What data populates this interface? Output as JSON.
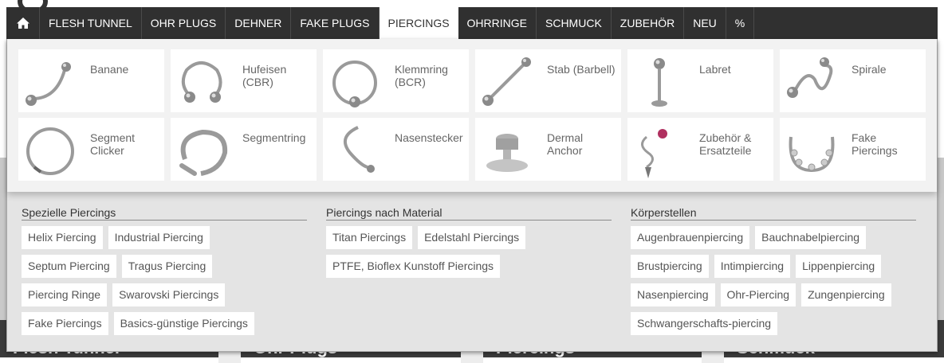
{
  "background": {
    "categories": [
      "Flesh Tunnel",
      "Ohr Plugs",
      "Piercings",
      "Schmuck"
    ]
  },
  "nav": {
    "home_icon": "home-icon",
    "items": [
      {
        "label": "FLESH TUNNEL"
      },
      {
        "label": "OHR PLUGS"
      },
      {
        "label": "DEHNER"
      },
      {
        "label": "FAKE PLUGS"
      },
      {
        "label": "PIERCINGS",
        "active": true
      },
      {
        "label": "OHRRINGE"
      },
      {
        "label": "SCHMUCK"
      },
      {
        "label": "ZUBEHÖR"
      },
      {
        "label": "NEU"
      },
      {
        "label": "%"
      }
    ]
  },
  "tiles": [
    {
      "label": "Banane",
      "icon": "banana-piercing-icon"
    },
    {
      "label": "Hufeisen (CBR)",
      "icon": "horseshoe-piercing-icon"
    },
    {
      "label": "Klemmring (BCR)",
      "icon": "ball-closure-ring-icon"
    },
    {
      "label": "Stab (Barbell)",
      "icon": "barbell-icon"
    },
    {
      "label": "Labret",
      "icon": "labret-icon"
    },
    {
      "label": "Spirale",
      "icon": "spiral-piercing-icon"
    },
    {
      "label": "Segment Clicker",
      "icon": "segment-clicker-icon"
    },
    {
      "label": "Segmentring",
      "icon": "segment-ring-icon"
    },
    {
      "label": "Nasenstecker",
      "icon": "nose-stud-icon"
    },
    {
      "label": "Dermal Anchor",
      "icon": "dermal-anchor-icon"
    },
    {
      "label": "Zubehör & Ersatzteile",
      "icon": "accessories-icon"
    },
    {
      "label": "Fake Piercings",
      "icon": "fake-piercing-icon"
    }
  ],
  "columns": [
    {
      "title": "Spezielle Piercings",
      "links": [
        "Helix Piercing",
        "Industrial Piercing",
        "Septum Piercing",
        "Tragus Piercing",
        "Piercing Ringe",
        "Swarovski Piercings",
        "Fake Piercings",
        "Basics-günstige Piercings"
      ]
    },
    {
      "title": "Piercings nach Material",
      "links": [
        "Titan Piercings",
        "Edelstahl Piercings",
        "PTFE, Bioflex Kunstoff Piercings"
      ]
    },
    {
      "title": "Körperstellen",
      "links": [
        "Augenbrauenpiercing",
        "Bauchnabelpiercing",
        "Brustpiercing",
        "Intimpiercing",
        "Lippenpiercing",
        "Nasenpiercing",
        "Ohr-Piercing",
        "Zungenpiercing",
        "Schwangerschafts-piercing"
      ]
    }
  ]
}
